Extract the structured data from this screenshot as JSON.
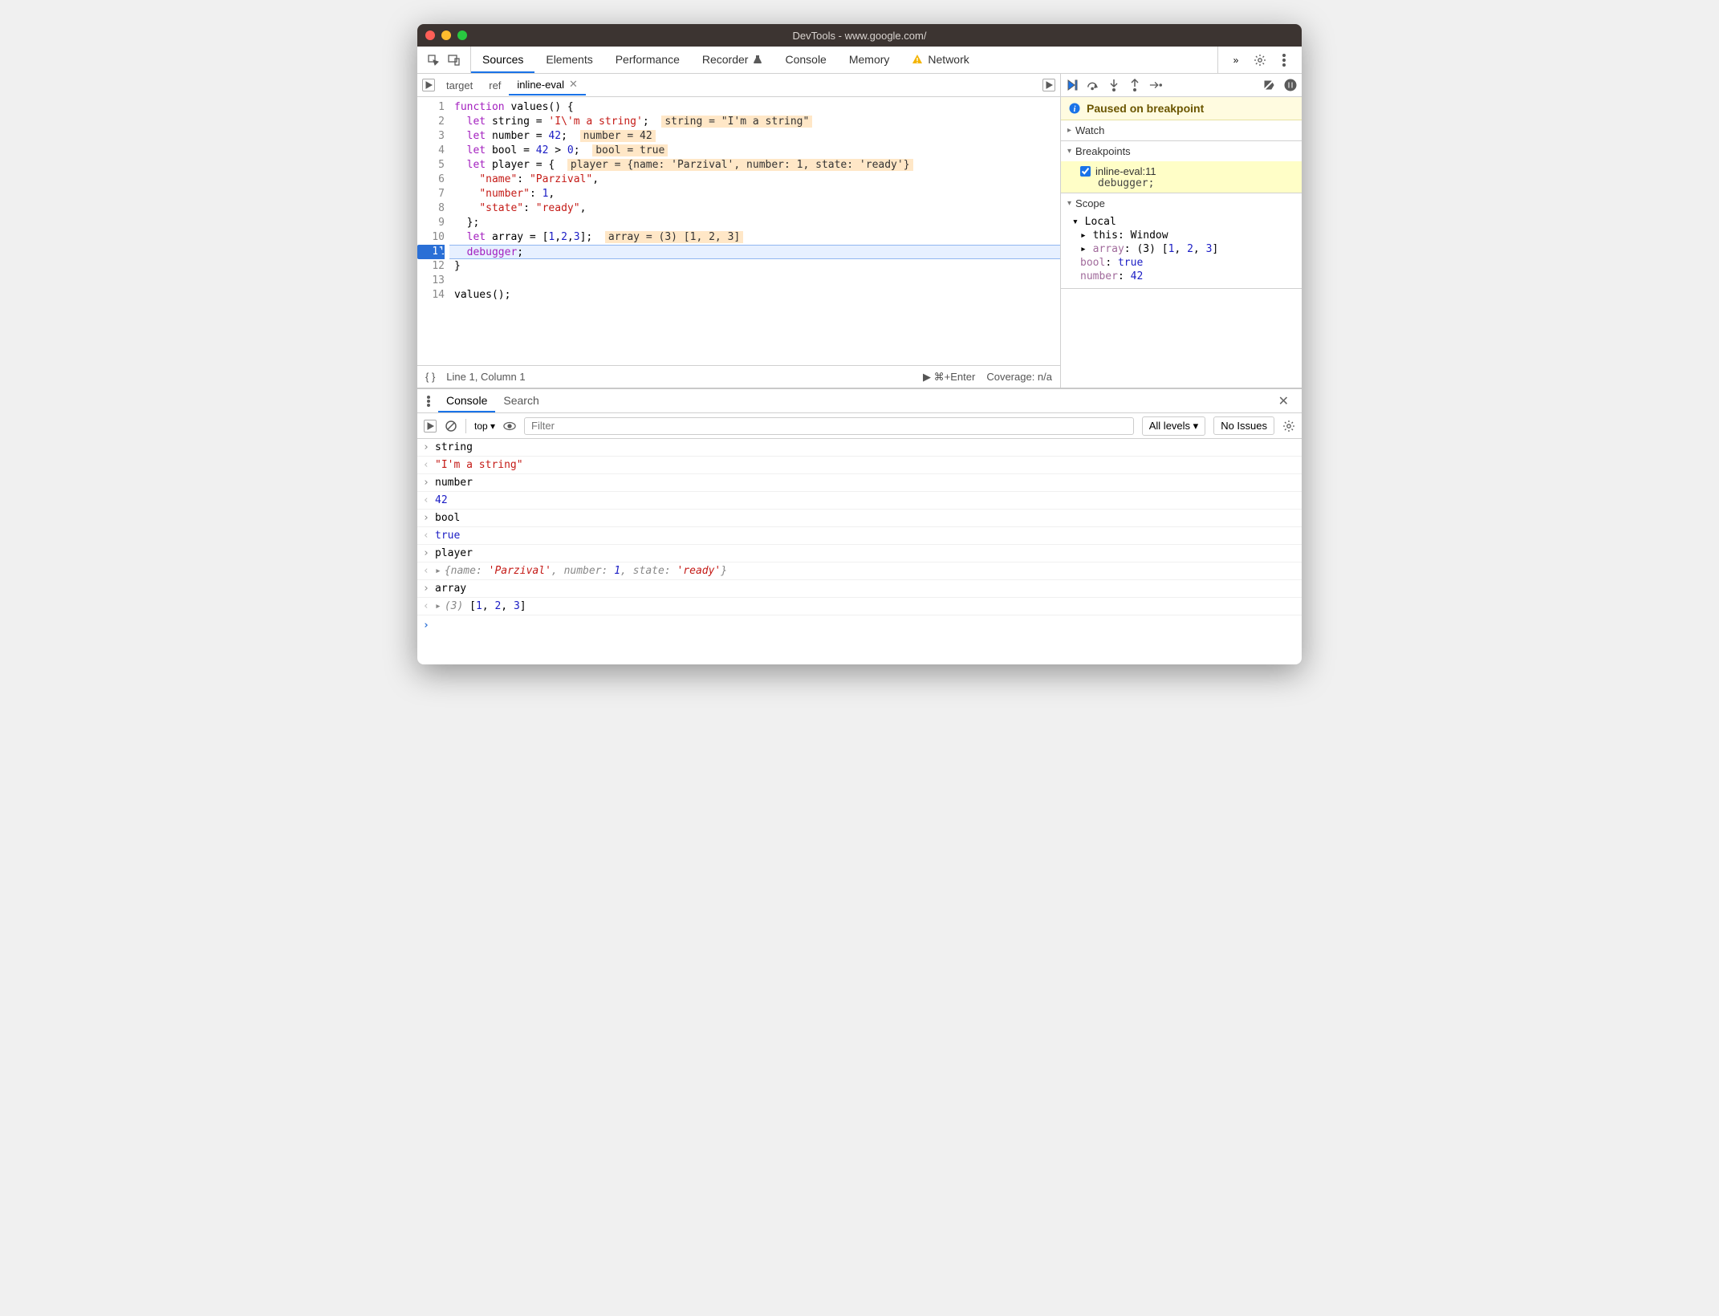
{
  "window": {
    "title": "DevTools - www.google.com/"
  },
  "mainTabs": [
    "Sources",
    "Elements",
    "Performance",
    "Recorder",
    "Console",
    "Memory",
    "Network"
  ],
  "mainTabsActive": 0,
  "networkWarn": true,
  "fileTabs": [
    {
      "label": "target",
      "active": false,
      "closable": false
    },
    {
      "label": "ref",
      "active": false,
      "closable": false
    },
    {
      "label": "inline-eval",
      "active": true,
      "closable": true
    }
  ],
  "code": {
    "lines": [
      {
        "n": 1,
        "html": "<span class='kw'>function</span> <span class='fn'>values</span>() {"
      },
      {
        "n": 2,
        "html": "  <span class='kw'>let</span> string = <span class='str'>'I\\'m a string'</span>;  <span class='inline-hint'>string = \"I'm a string\"</span>"
      },
      {
        "n": 3,
        "html": "  <span class='kw'>let</span> number = <span class='num'>42</span>;  <span class='inline-hint'>number = 42</span>"
      },
      {
        "n": 4,
        "html": "  <span class='kw'>let</span> bool = <span class='num'>42</span> &gt; <span class='num'>0</span>;  <span class='inline-hint'>bool = true</span>"
      },
      {
        "n": 5,
        "html": "  <span class='kw'>let</span> player = {  <span class='inline-hint'>player = {name: 'Parzival', number: 1, state: 'ready'}</span>"
      },
      {
        "n": 6,
        "html": "    <span class='prop'>\"name\"</span>: <span class='str'>\"Parzival\"</span>,"
      },
      {
        "n": 7,
        "html": "    <span class='prop'>\"number\"</span>: <span class='num'>1</span>,"
      },
      {
        "n": 8,
        "html": "    <span class='prop'>\"state\"</span>: <span class='str'>\"ready\"</span>,"
      },
      {
        "n": 9,
        "html": "  };"
      },
      {
        "n": 10,
        "html": "  <span class='kw'>let</span> array = [<span class='num'>1</span>,<span class='num'>2</span>,<span class='num'>3</span>];  <span class='inline-hint'>array = (3) [1, 2, 3]</span>"
      },
      {
        "n": 11,
        "html": "  <span class='dbg'>debugger</span>;",
        "hl": true,
        "bp": true
      },
      {
        "n": 12,
        "html": "}"
      },
      {
        "n": 13,
        "html": ""
      },
      {
        "n": 14,
        "html": "values();"
      }
    ]
  },
  "statusBar": {
    "pos": "Line 1, Column 1",
    "run": "⌘+Enter",
    "coverage": "Coverage: n/a"
  },
  "pausedBanner": "Paused on breakpoint",
  "sections": {
    "watch": "Watch",
    "breakpoints": "Breakpoints",
    "scope": "Scope"
  },
  "breakpoint": {
    "label": "inline-eval:11",
    "sub": "debugger;",
    "checked": true
  },
  "scope": {
    "localLabel": "Local",
    "entries": [
      {
        "html": "▸ this: Window"
      },
      {
        "html": "▸ <span class='k'>array</span>: (3) [<span class='v-num'>1</span>, <span class='v-num'>2</span>, <span class='v-num'>3</span>]"
      },
      {
        "html": "  <span class='k'>bool</span>: <span class='v-bool'>true</span>"
      },
      {
        "html": "  <span class='k'>number</span>: <span class='v-num'>42</span>"
      }
    ]
  },
  "drawer": {
    "tabs": [
      {
        "label": "Console",
        "active": true
      },
      {
        "label": "Search",
        "active": false
      }
    ],
    "context": "top",
    "filterPlaceholder": "Filter",
    "levels": "All levels",
    "issues": "No Issues",
    "log": [
      {
        "type": "in",
        "text": "string"
      },
      {
        "type": "out",
        "html": "<span class='str'>\"I'm a string\"</span>"
      },
      {
        "type": "in",
        "text": "number"
      },
      {
        "type": "out",
        "html": "<span class='v-num'>42</span>"
      },
      {
        "type": "in",
        "text": "bool"
      },
      {
        "type": "out",
        "html": "<span class='v-bool'>true</span>"
      },
      {
        "type": "in",
        "text": "player"
      },
      {
        "type": "out",
        "html": "<span class='ex-tri'>▸</span><span class='obj'>{<span class='k2'>name</span>: <span class='v2s'>'Parzival'</span>, <span class='k2'>number</span>: <span class='v2n'>1</span>, <span class='k2'>state</span>: <span class='v2s'>'ready'</span>}</span>"
      },
      {
        "type": "in",
        "text": "array"
      },
      {
        "type": "out",
        "html": "<span class='ex-tri'>▸</span><span class='obj'>(3)</span> [<span class='v-num'>1</span>, <span class='v-num'>2</span>, <span class='v-num'>3</span>]"
      }
    ]
  }
}
